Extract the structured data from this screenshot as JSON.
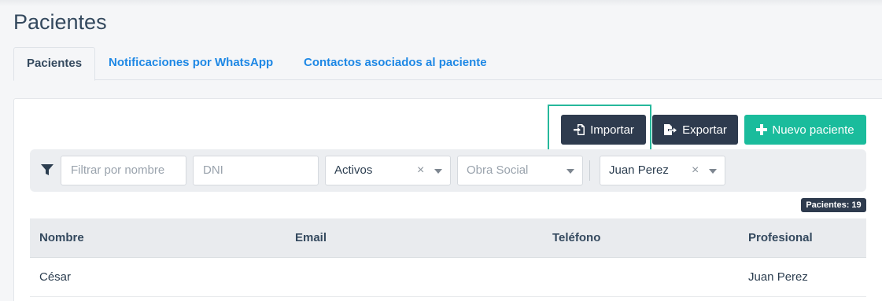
{
  "page": {
    "title": "Pacientes"
  },
  "tabs": [
    {
      "label": "Pacientes",
      "active": true
    },
    {
      "label": "Notificaciones por WhatsApp",
      "active": false
    },
    {
      "label": "Contactos asociados al paciente",
      "active": false
    }
  ],
  "toolbar": {
    "import_label": "Importar",
    "export_label": "Exportar",
    "new_label": "Nuevo paciente",
    "import_icon": "file-import-icon",
    "export_icon": "file-export-icon",
    "new_icon": "plus-icon"
  },
  "filters": {
    "icon": "filter-icon",
    "name_placeholder": "Filtrar por nombre",
    "dni_placeholder": "DNI",
    "status_value": "Activos",
    "insurance_placeholder": "Obra Social",
    "professional_value": "Juan Perez",
    "clear_glyph": "×"
  },
  "count_badge": "Pacientes: 19",
  "table": {
    "columns": [
      "Nombre",
      "Email",
      "Teléfono",
      "Profesional"
    ],
    "rows": [
      [
        "César",
        "",
        "",
        "Juan Perez"
      ]
    ]
  },
  "colors": {
    "primary_dark": "#2e3b4e",
    "accent_green": "#1abc9c",
    "link_blue": "#1e88e5",
    "highlight": "#26b89c"
  }
}
